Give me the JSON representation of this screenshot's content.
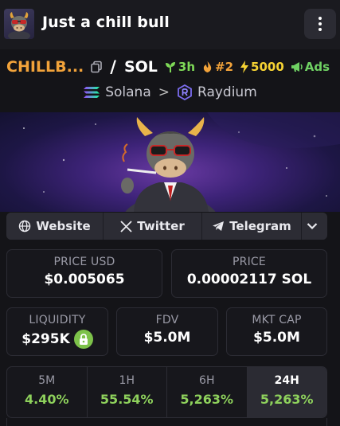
{
  "header": {
    "title": "Just a chill bull",
    "menu_icon": "kebab-menu-icon"
  },
  "token": {
    "symbol": "CHILLB...",
    "separator": "/",
    "quote": "SOL",
    "age": "3h",
    "rank": "#2",
    "boosts": "5000",
    "ads": "Ads",
    "colors": {
      "symbol": "#f2a33a",
      "age": "#7ed957",
      "rank": "#f2a33a",
      "boosts": "#f5d233",
      "ads": "#6fd163"
    }
  },
  "chain": {
    "network": "Solana",
    "dex": "Raydium"
  },
  "links": {
    "website": "Website",
    "twitter": "Twitter",
    "telegram": "Telegram"
  },
  "stats": {
    "price_usd": {
      "label": "PRICE USD",
      "value": "$0.005065"
    },
    "price": {
      "label": "PRICE",
      "value": "0.00002117 SOL"
    },
    "liquidity": {
      "label": "LIQUIDITY",
      "value": "$295K"
    },
    "fdv": {
      "label": "FDV",
      "value": "$5.0M"
    },
    "mkt_cap": {
      "label": "MKT CAP",
      "value": "$5.0M"
    }
  },
  "timeframes": [
    {
      "label": "5M",
      "value": "4.40%"
    },
    {
      "label": "1H",
      "value": "55.54%"
    },
    {
      "label": "6H",
      "value": "5,263%"
    },
    {
      "label": "24H",
      "value": "5,263%",
      "active": true
    }
  ]
}
